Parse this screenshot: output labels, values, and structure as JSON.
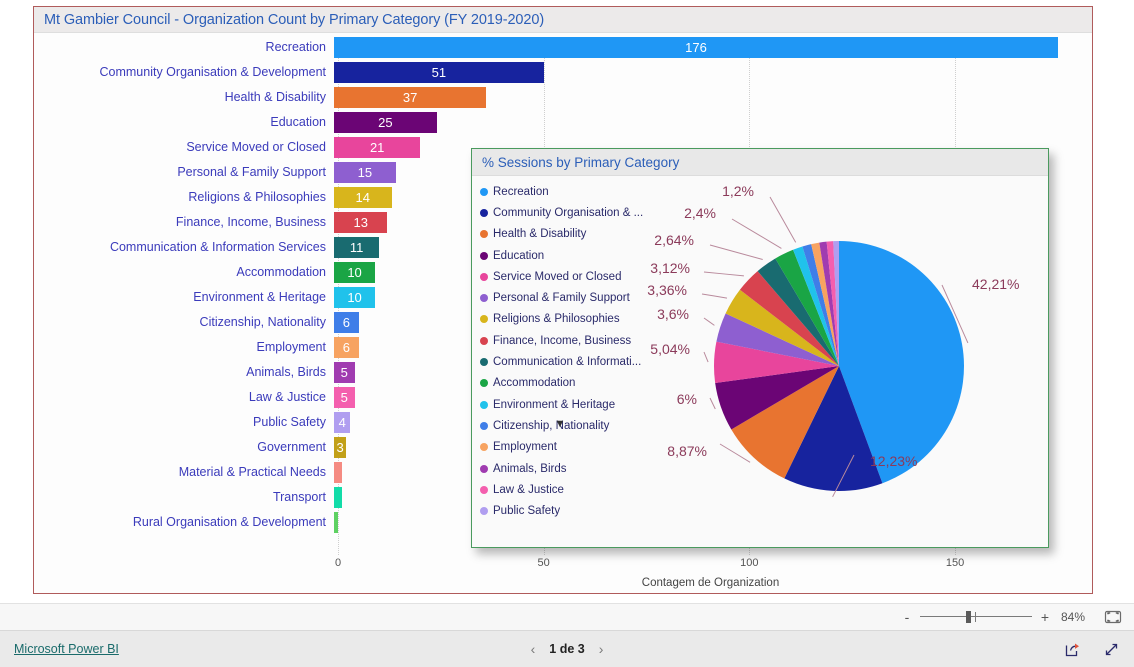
{
  "report": {
    "bar_visual_title": "Mt Gambier Council - Organization Count by Primary Category (FY 2019-2020)",
    "pie_visual_title": "% Sessions by Primary Category",
    "legend_more_icon": "chevron-down-icon"
  },
  "chart_data": [
    {
      "type": "bar",
      "title": "Mt Gambier Council - Organization Count by Primary Category (FY 2019-2020)",
      "xlabel": "Contagem de Organization",
      "ylabel": "",
      "xlim": [
        0,
        176
      ],
      "xticks": [
        "0",
        "50",
        "100",
        "150"
      ],
      "xtick_values": [
        0,
        50,
        100,
        150
      ],
      "grid": true,
      "orientation": "horizontal",
      "categories": [
        "Recreation",
        "Community Organisation & Development",
        "Health & Disability",
        "Education",
        "Service Moved or Closed",
        "Personal & Family Support",
        "Religions & Philosophies",
        "Finance, Income, Business",
        "Communication & Information Services",
        "Accommodation",
        "Environment & Heritage",
        "Citizenship, Nationality",
        "Employment",
        "Animals, Birds",
        "Law & Justice",
        "Public Safety",
        "Government",
        "Material & Practical Needs",
        "Transport",
        "Rural Organisation & Development"
      ],
      "values": [
        176,
        51,
        37,
        25,
        21,
        15,
        14,
        13,
        11,
        10,
        10,
        6,
        6,
        5,
        5,
        4,
        3,
        2,
        2,
        1
      ],
      "value_labels": [
        "176",
        "51",
        "37",
        "25",
        "21",
        "15",
        "14",
        "13",
        "11",
        "10",
        "10",
        "6",
        "6",
        "5",
        "5",
        "4",
        "3",
        "",
        "",
        ""
      ],
      "colors": [
        "#1f97f5",
        "#17239e",
        "#e87430",
        "#6b0575",
        "#e8459c",
        "#8e5fd0",
        "#d8b51c",
        "#d8434f",
        "#196b70",
        "#1aa545",
        "#20c2eb",
        "#3f7ee8",
        "#f7a361",
        "#a03cb0",
        "#f45fae",
        "#b09ef0",
        "#c2a018",
        "#f58b82",
        "#12dca8",
        "#5ed162"
      ]
    },
    {
      "type": "pie",
      "title": "% Sessions by Primary Category",
      "legend_position": "left",
      "labels": [
        "Recreation",
        "Community Organisation & ...",
        "Health & Disability",
        "Education",
        "Service Moved or Closed",
        "Personal & Family Support",
        "Religions & Philosophies",
        "Finance, Income, Business",
        "Communication & Informati...",
        "Accommodation",
        "Environment & Heritage",
        "Citizenship, Nationality",
        "Employment",
        "Animals, Birds",
        "Law & Justice",
        "Public Safety"
      ],
      "values": [
        42.21,
        12.23,
        8.87,
        6,
        5.04,
        3.6,
        3.36,
        3.12,
        2.64,
        2.4,
        1.2,
        1.1,
        1.0,
        0.9,
        0.8,
        0.7
      ],
      "visible_value_labels": [
        "42,21%",
        "12,23%",
        "8,87%",
        "6%",
        "5,04%",
        "3,6%",
        "3,36%",
        "3,12%",
        "2,64%",
        "2,4%",
        "1,2%"
      ],
      "colors": [
        "#1f97f5",
        "#17239e",
        "#e87430",
        "#6b0575",
        "#e8459c",
        "#8e5fd0",
        "#d8b51c",
        "#d8434f",
        "#196b70",
        "#1aa545",
        "#20c2eb",
        "#3f7ee8",
        "#f7a361",
        "#a03cb0",
        "#f45fae",
        "#b09ef0",
        "#c2a018",
        "#12dca8"
      ]
    }
  ],
  "zoombar": {
    "minus_label": "-",
    "plus_label": "+",
    "zoom_level": "84%",
    "fit_icon": "fit-to-page-icon"
  },
  "footer": {
    "brand_link": "Microsoft Power BI",
    "prev_icon": "chevron-left-icon",
    "next_icon": "chevron-right-icon",
    "page_label": "1 de 3",
    "share_icon": "share-icon",
    "fullscreen_icon": "fullscreen-icon"
  }
}
